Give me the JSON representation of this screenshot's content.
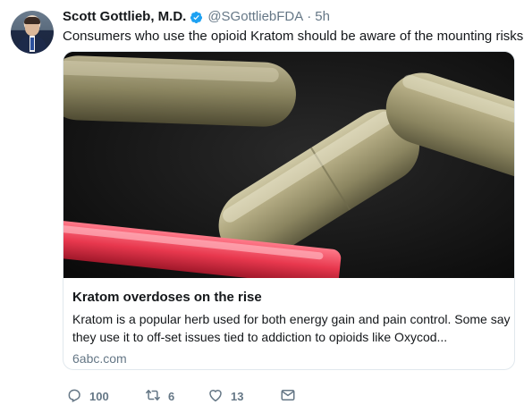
{
  "tweet": {
    "author_name": "Scott Gottlieb, M.D.",
    "verified_icon": "verified-badge-icon",
    "handle": "@SGottliebFDA",
    "separator": "·",
    "time": "5h",
    "text": "Consumers who use the opioid Kratom should be aware of the mounting risks"
  },
  "card": {
    "image_description_icon": "kratom-capsules-photo",
    "title": "Kratom overdoses on the rise",
    "description": "Kratom is a popular herb used for both energy gain and pain control. Some say they use it to off-set issues tied to addiction to opioids like Oxycod...",
    "domain": "6abc.com"
  },
  "actions": {
    "reply_count": "100",
    "retweet_count": "6",
    "like_count": "13"
  },
  "colors": {
    "text": "#14171a",
    "secondary": "#657786",
    "verified": "#1da1f2",
    "border": "#e1e8ed"
  }
}
